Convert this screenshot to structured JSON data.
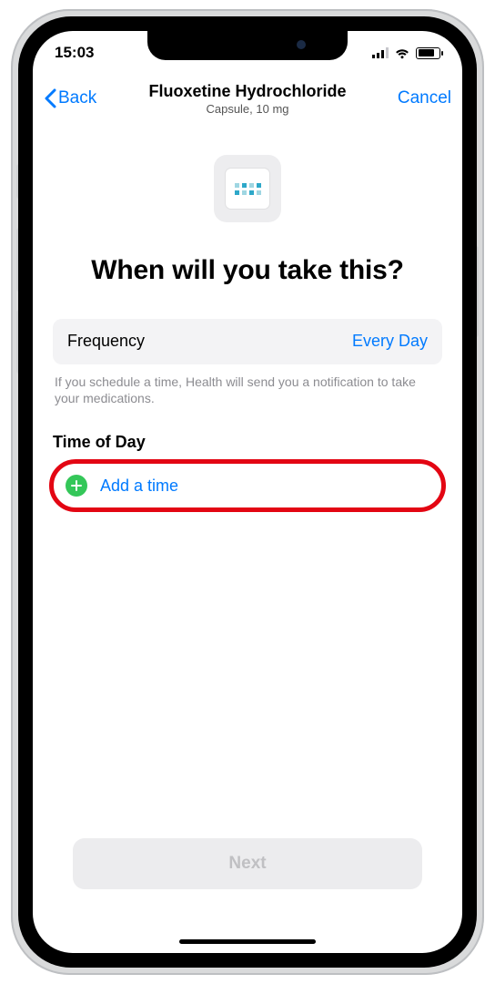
{
  "status": {
    "time": "15:03"
  },
  "nav": {
    "back": "Back",
    "title": "Fluoxetine Hydrochloride",
    "subtitle": "Capsule, 10 mg",
    "cancel": "Cancel"
  },
  "headline": "When will you take this?",
  "frequency": {
    "label": "Frequency",
    "value": "Every Day"
  },
  "hint": "If you schedule a time, Health will send you a notification to take your medications.",
  "timeOfDay": {
    "section": "Time of Day",
    "addLabel": "Add a time"
  },
  "next": {
    "label": "Next"
  }
}
